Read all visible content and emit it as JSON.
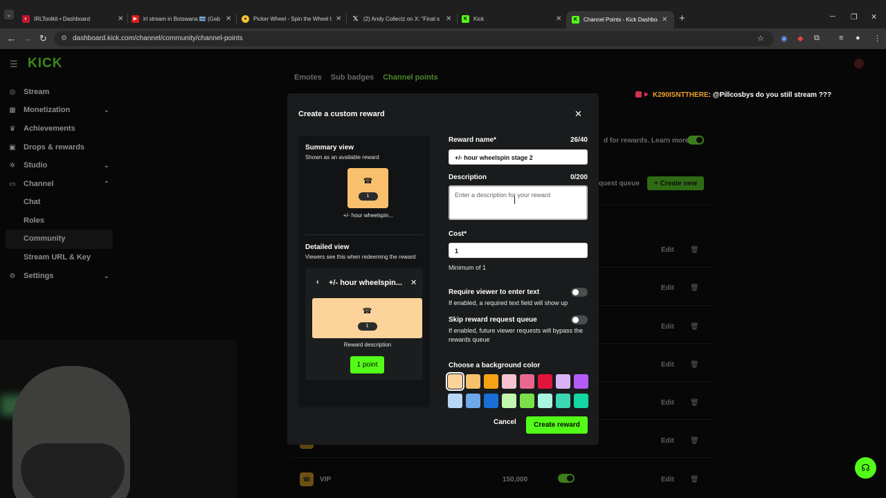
{
  "browser": {
    "tabs": [
      {
        "title": "IRLToolkit • Dashboard",
        "favicon": "irltoolkit-icon"
      },
      {
        "title": "irl stream in Botswana 🇧🇼 (Gab",
        "favicon": "youtube-icon"
      },
      {
        "title": "Picker Wheel - Spin the Wheel t",
        "favicon": "picker-wheel-icon"
      },
      {
        "title": "(2) Andy Collectz on X: \"Final s",
        "favicon": "x-icon"
      },
      {
        "title": "Kick",
        "favicon": "kick-icon"
      },
      {
        "title": "Channel Points - Kick Dashboar",
        "favicon": "kick-icon",
        "active": true
      }
    ],
    "url": "dashboard.kick.com/channel/community/channel-points"
  },
  "sidebar": {
    "logo": "KICK",
    "items": [
      {
        "label": "Stream",
        "icon": "broadcast-icon"
      },
      {
        "label": "Monetization",
        "icon": "grid-icon"
      },
      {
        "label": "Achievements",
        "icon": "trophy-icon"
      },
      {
        "label": "Drops & rewards",
        "icon": "gift-icon"
      },
      {
        "label": "Studio",
        "icon": "studio-icon"
      },
      {
        "label": "Channel",
        "icon": "channel-icon"
      }
    ],
    "channel_sub": [
      "Chat",
      "Roles",
      "Community",
      "Stream URL & Key"
    ],
    "settings": "Settings"
  },
  "background": {
    "tabs": [
      "Emotes",
      "Sub badges",
      "Channel points"
    ],
    "rewards_hint": "d for rewards. Learn more",
    "request_queue": "quest queue",
    "create_new": "+ Create new",
    "edit_label": "Edit",
    "vip_name": "VIP",
    "vip_cost": "150,000"
  },
  "chat": {
    "user": "K290ISNTTHERE",
    "message": ": @Pillcosbys do you still stream ???"
  },
  "modal": {
    "title": "Create a custom reward",
    "summary_title": "Summary view",
    "summary_sub": "Shown as an available reward",
    "card_count": "1",
    "card_name": "+/- hour wheelspin...",
    "detailed_title": "Detailed view",
    "detailed_sub": "Viewers see this when redeeming the reward",
    "detail_header": "+/- hour wheelspin...",
    "reward_description": "Reward description",
    "point_button": "1 point",
    "reward_name_label": "Reward name*",
    "reward_name_count": "26/40",
    "reward_name_value": "+/- hour wheelspin stage 2",
    "description_label": "Description",
    "description_count": "0/200",
    "description_placeholder": "Enter a description for your reward",
    "cost_label": "Cost*",
    "cost_value": "1",
    "cost_min": "Minimum of 1",
    "require_text_label": "Require viewer to enter text",
    "require_text_help": "If enabled, a required text field will show up",
    "require_text_enabled": false,
    "skip_queue_label": "Skip reward request queue",
    "skip_queue_help": "If enabled, future viewer requests will bypass the rewards queue",
    "skip_queue_enabled": false,
    "bg_color_label": "Choose a background color",
    "colors_row1": [
      "#fcd39b",
      "#f8c06d",
      "#f5a314",
      "#f7c2d1",
      "#e8678f",
      "#e0143c",
      "#d9b3f5",
      "#b35cf5"
    ],
    "colors_row2": [
      "#b8d6f5",
      "#6ea8e8",
      "#1a6fd6",
      "#c2f5ad",
      "#7ae04a",
      "#a8f5e0",
      "#3dd6b3",
      "#14d6a3"
    ],
    "selected_color": "#fcd39b",
    "cancel": "Cancel",
    "create": "Create reward"
  }
}
